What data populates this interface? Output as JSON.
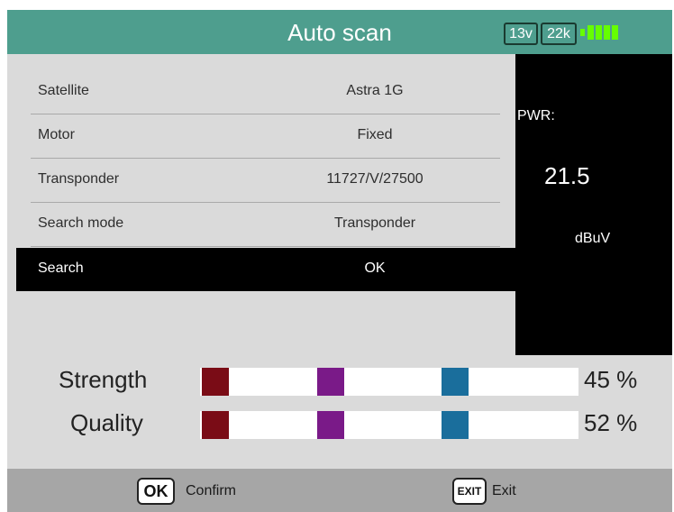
{
  "header": {
    "title": "Auto scan",
    "voltage_badge": "13v",
    "tone_badge": "22k",
    "battery_icon": "battery-icon"
  },
  "settings": {
    "rows": [
      {
        "label": "Satellite",
        "value": "Astra 1G"
      },
      {
        "label": "Motor",
        "value": "Fixed"
      },
      {
        "label": "Transponder",
        "value": "11727/V/27500"
      },
      {
        "label": "Search mode",
        "value": "Transponder"
      },
      {
        "label": "Search",
        "value": "OK",
        "selected": true
      }
    ]
  },
  "power": {
    "label": "PWR:",
    "value": "21.5",
    "unit": "dBuV"
  },
  "metrics": {
    "strength": {
      "label": "Strength",
      "value": "45 %",
      "percent": 45
    },
    "quality": {
      "label": "Quality",
      "value": "52 %",
      "percent": 52
    }
  },
  "footer": {
    "ok_key": "OK",
    "confirm_label": "Confirm",
    "exit_key": "EXIT",
    "exit_label": "Exit"
  },
  "colors": {
    "header_bg": "#4e9e8e",
    "battery": "#66ff00",
    "bar_segment_1": "#7a0c16",
    "bar_segment_2": "#7a1a88",
    "bar_segment_3": "#1a6e9c"
  }
}
